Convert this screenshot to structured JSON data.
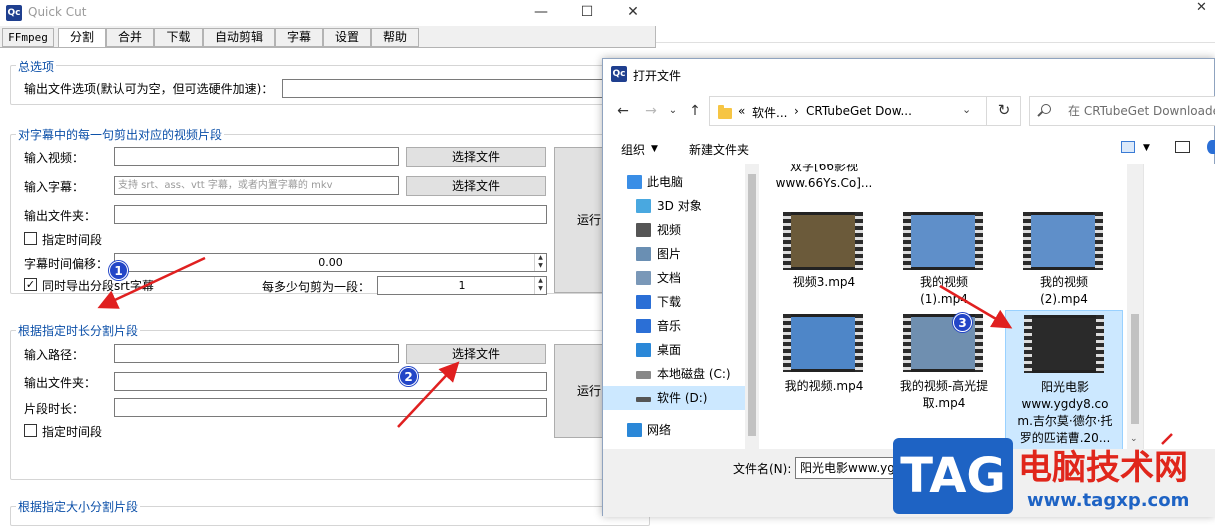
{
  "app": {
    "title": "Quick Cut",
    "logo": "Qc",
    "tabs": [
      "FFmpeg",
      "分割",
      "合并",
      "下载",
      "自动剪辑",
      "字幕",
      "设置",
      "帮助"
    ],
    "active_tab": "分割"
  },
  "general": {
    "title": "总选项",
    "output_options_label": "输出文件选项(默认可为空，但可选硬件加速)："
  },
  "subtitle_section": {
    "title": "对字幕中的每一句剪出对应的视频片段",
    "input_video_label": "输入视频：",
    "input_subtitle_label": "输入字幕：",
    "subtitle_placeholder": "支持 srt、ass、vtt 字幕，或者内置字幕的 mkv",
    "output_folder_label": "输出文件夹：",
    "select_file_label": "选择文件",
    "run_label": "运行",
    "time_range_label": "指定时间段",
    "offset_label": "字幕时间偏移：",
    "offset_value": "0.00",
    "export_srt_label": "同时导出分段srt字幕",
    "per_segment_label": "每多少句剪为一段：",
    "per_segment_value": "1"
  },
  "duration_section": {
    "title": "根据指定时长分割片段",
    "input_path_label": "输入路径：",
    "output_folder_label": "输出文件夹：",
    "segment_duration_label": "片段时长：",
    "select_file_label": "选择文件",
    "run_label": "运行",
    "time_range_label": "指定时间段"
  },
  "size_section": {
    "title": "根据指定大小分割片段"
  },
  "dialog": {
    "logo": "Qc",
    "title": "打开文件",
    "address": {
      "prefix": "«",
      "crumb1": "软件...",
      "sep": "›",
      "crumb2": "CRTubeGet Dow..."
    },
    "search_placeholder": "在 CRTubeGet Downloade",
    "organize_label": "组织",
    "new_folder_label": "新建文件夹",
    "nav": [
      {
        "label": "此电脑",
        "icon": "pc-icon",
        "color": "#3a8ee6"
      },
      {
        "label": "3D 对象",
        "icon": "cube-icon",
        "color": "#49a8e0"
      },
      {
        "label": "视频",
        "icon": "video-icon",
        "color": "#555555"
      },
      {
        "label": "图片",
        "icon": "picture-icon",
        "color": "#6a8fb3"
      },
      {
        "label": "文档",
        "icon": "document-icon",
        "color": "#7a98b8"
      },
      {
        "label": "下载",
        "icon": "download-icon",
        "color": "#2b6fd6"
      },
      {
        "label": "音乐",
        "icon": "music-icon",
        "color": "#2b6fd6"
      },
      {
        "label": "桌面",
        "icon": "desktop-icon",
        "color": "#2b88d8"
      },
      {
        "label": "本地磁盘 (C:)",
        "icon": "drive-icon",
        "color": "#888888"
      },
      {
        "label": "软件 (D:)",
        "icon": "drive-icon",
        "color": "#555555"
      },
      {
        "label": "网络",
        "icon": "network-icon",
        "color": "#2b88d8"
      }
    ],
    "selected_nav": "软件 (D:)",
    "top_partial_name": "双字[66影视\nwww.66Ys.Co]...",
    "files": [
      {
        "name": "视频3.mp4",
        "thumb": "#6b5a3a"
      },
      {
        "name": "我的视频\n(1).mp4",
        "thumb": "#5f8fc9"
      },
      {
        "name": "我的视频\n(2).mp4",
        "thumb": "#5f8fc9"
      },
      {
        "name": "我的视频.mp4",
        "thumb": "#4e86c8"
      },
      {
        "name": "我的视频-高光提\n取.mp4",
        "thumb": "#6f8fb0"
      },
      {
        "name": "阳光电影\nwww.ygdy8.co\nm.吉尔莫·德尔·托\n罗的匹诺曹.20...",
        "thumb": "#2a2a2a"
      }
    ],
    "filename_label": "文件名(N):",
    "filename_value": "阳光电影www.ygdy"
  },
  "watermark": {
    "tag": "TAG",
    "name": "电脑技术网",
    "url": "www.tagxp.com"
  },
  "markers": [
    "1",
    "2",
    "3"
  ],
  "colors": {
    "accent": "#0b4fa8",
    "selection": "#cce8ff",
    "arrow": "#e02020"
  }
}
